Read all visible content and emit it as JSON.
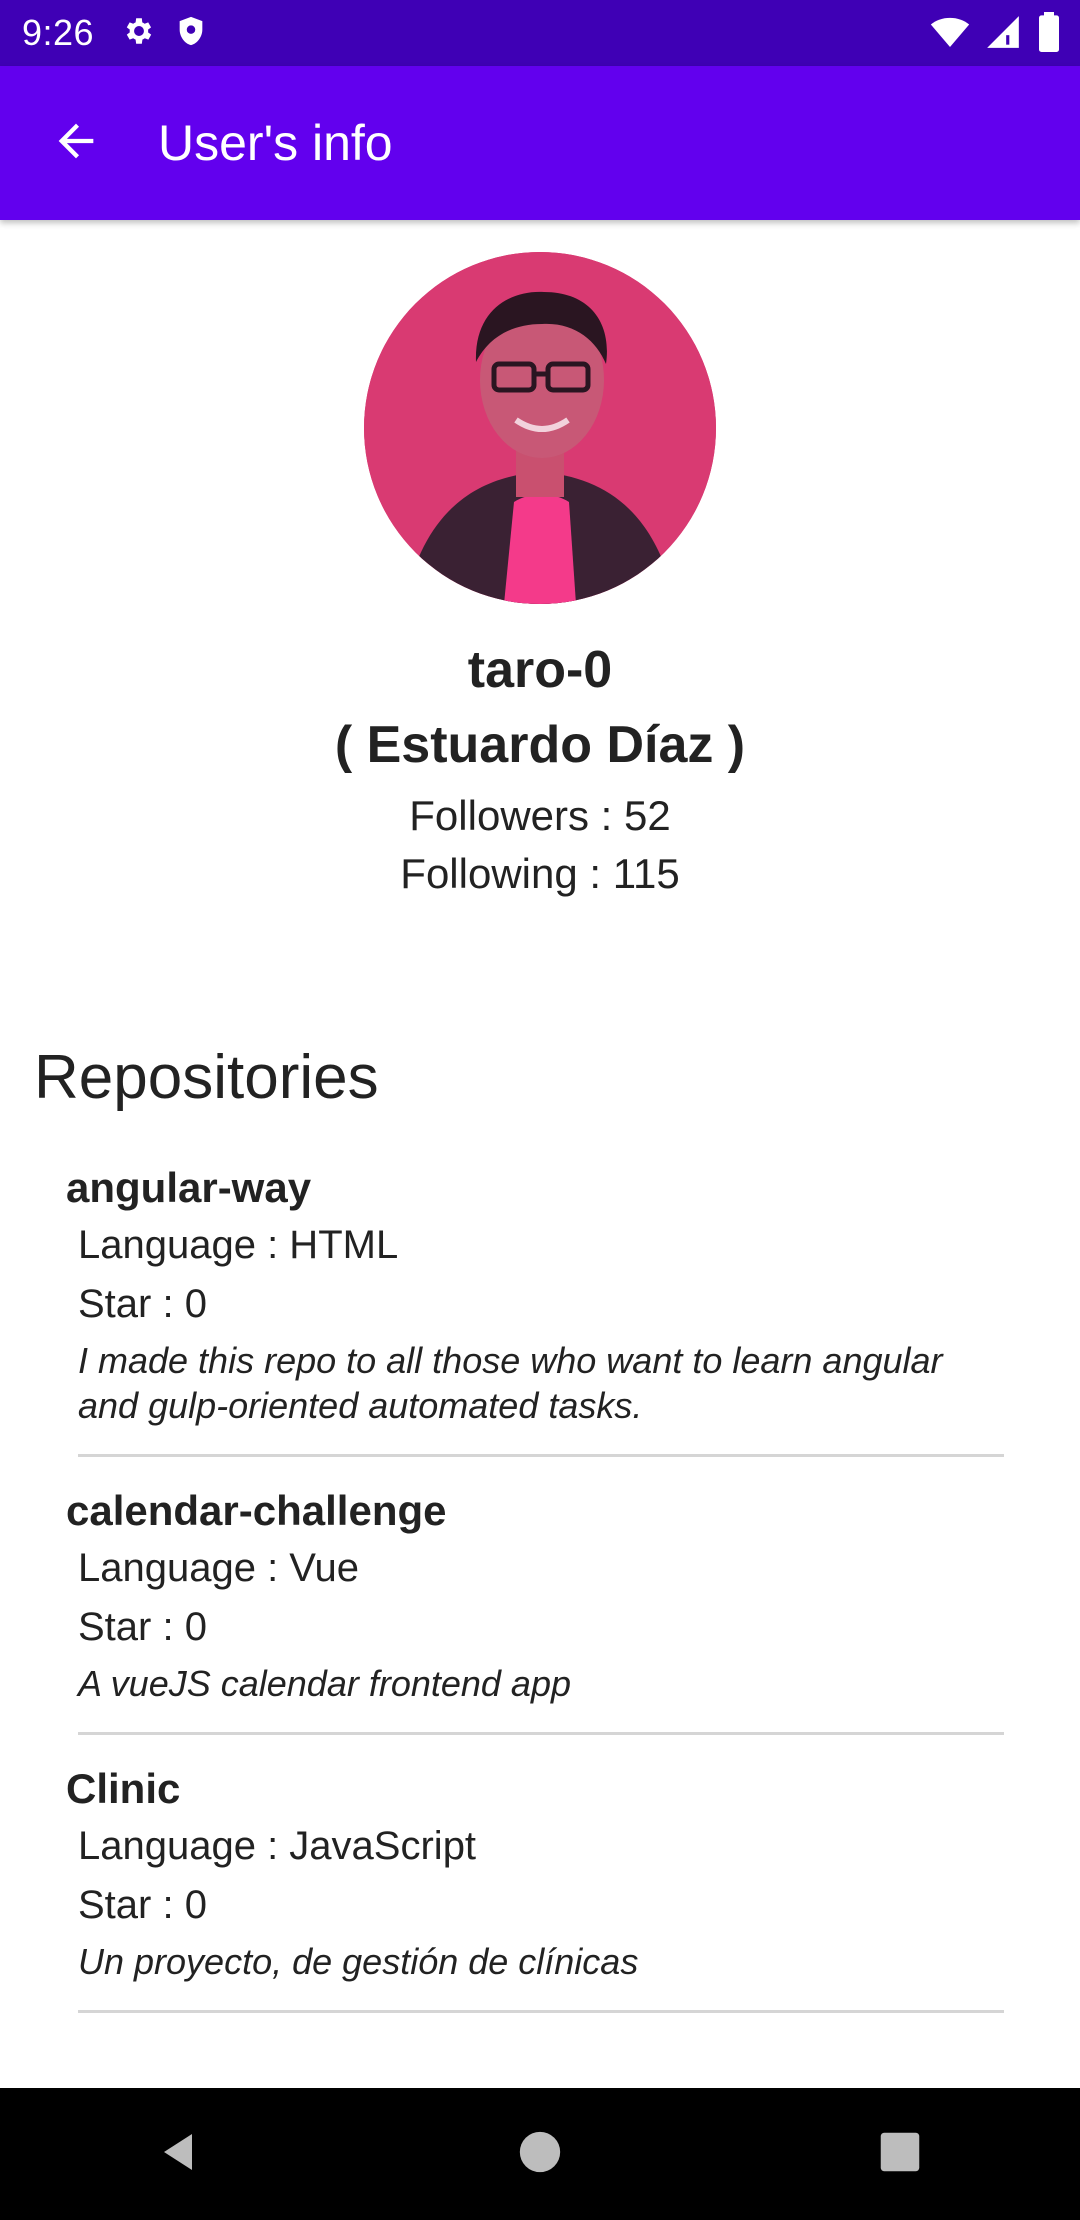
{
  "status_bar": {
    "time": "9:26",
    "icons": [
      "gear-icon",
      "shield-icon",
      "wifi-icon",
      "signal-icon",
      "battery-icon"
    ]
  },
  "app_bar": {
    "title": "User's info",
    "back_icon": "arrow-back-icon",
    "background": "#6200ee"
  },
  "profile": {
    "username": "taro-0",
    "full_name": "( Estuardo Díaz )",
    "followers": "Followers : 52",
    "following": "Following : 115"
  },
  "repositories": {
    "heading": "Repositories",
    "items": [
      {
        "name": "angular-way",
        "language": "Language : HTML",
        "stars": "Star : 0",
        "description": "I made this repo to all those who want to learn angular and gulp-oriented automated tasks."
      },
      {
        "name": "calendar-challenge",
        "language": "Language : Vue",
        "stars": "Star : 0",
        "description": "A vueJS calendar frontend app"
      },
      {
        "name": "Clinic",
        "language": "Language : JavaScript",
        "stars": "Star : 0",
        "description": "Un proyecto, de gestión de clínicas"
      }
    ]
  },
  "nav_bar": {
    "icons": [
      "back-triangle-icon",
      "home-circle-icon",
      "recents-square-icon"
    ]
  }
}
